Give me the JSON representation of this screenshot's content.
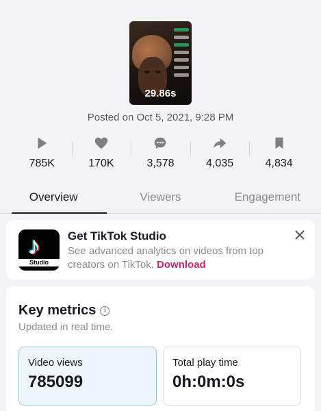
{
  "video": {
    "duration": "29.86s",
    "posted": "Posted on Oct 5, 2021, 9:28 PM"
  },
  "stats": [
    {
      "icon": "play-icon",
      "value": "785K"
    },
    {
      "icon": "heart-icon",
      "value": "170K"
    },
    {
      "icon": "comment-icon",
      "value": "3,578"
    },
    {
      "icon": "share-icon",
      "value": "4,035"
    },
    {
      "icon": "bookmark-icon",
      "value": "4,834"
    }
  ],
  "tabs": [
    {
      "label": "Overview",
      "active": true
    },
    {
      "label": "Viewers",
      "active": false
    },
    {
      "label": "Engagement",
      "active": false
    }
  ],
  "promo": {
    "logo_text": "Studio",
    "title": "Get TikTok Studio",
    "text": "See advanced analytics on videos from top creators on TikTok.",
    "link": "Download"
  },
  "metrics": {
    "title": "Key metrics",
    "subtitle": "Updated in real time.",
    "boxes": [
      {
        "label": "Video views",
        "value": "785099"
      },
      {
        "label": "Total play time",
        "value": "0h:0m:0s"
      }
    ]
  },
  "colors": {
    "accent_link": "#c8286a",
    "selected_box": "#eef6fb"
  }
}
